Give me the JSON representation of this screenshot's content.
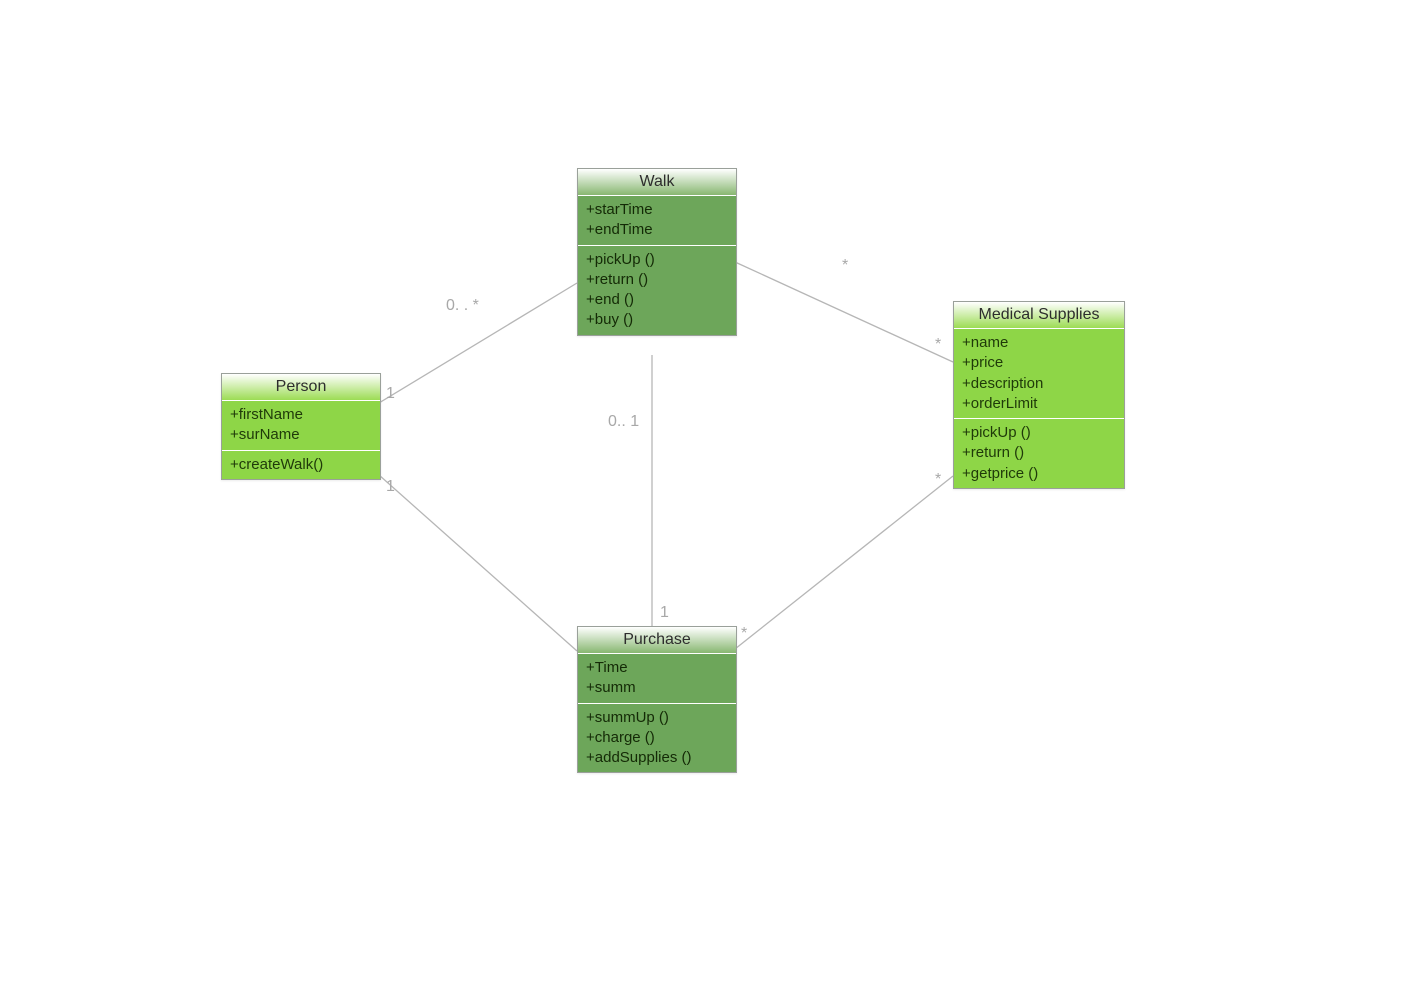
{
  "classes": {
    "person": {
      "name": "Person",
      "attributes": [
        "+firstName",
        "+surName"
      ],
      "methods": [
        "+createWalk()"
      ]
    },
    "walk": {
      "name": "Walk",
      "attributes": [
        "+starTime",
        "+endTime"
      ],
      "methods": [
        "+pickUp ()",
        "+return ()",
        "+end ()",
        "+buy ()"
      ]
    },
    "medical": {
      "name": "Medical Supplies",
      "attributes": [
        "+name",
        "+price",
        "+description",
        "+orderLimit"
      ],
      "methods": [
        "+pickUp ()",
        "+return ()",
        "+getprice ()"
      ]
    },
    "purchase": {
      "name": "Purchase",
      "attributes": [
        "+Time",
        "+summ"
      ],
      "methods": [
        "+summUp ()",
        "+charge ()",
        "+addSupplies ()"
      ]
    }
  },
  "mult": {
    "person_walk_person": "1",
    "person_walk_walk": "0. . *",
    "person_purchase_person": "1",
    "walk_purchase_walk": "0.. 1",
    "walk_purchase_purchase": "1",
    "walk_medical_walk": "*",
    "walk_medical_medical": "*",
    "purchase_medical_purchase": "*",
    "purchase_medical_medical": "*"
  }
}
